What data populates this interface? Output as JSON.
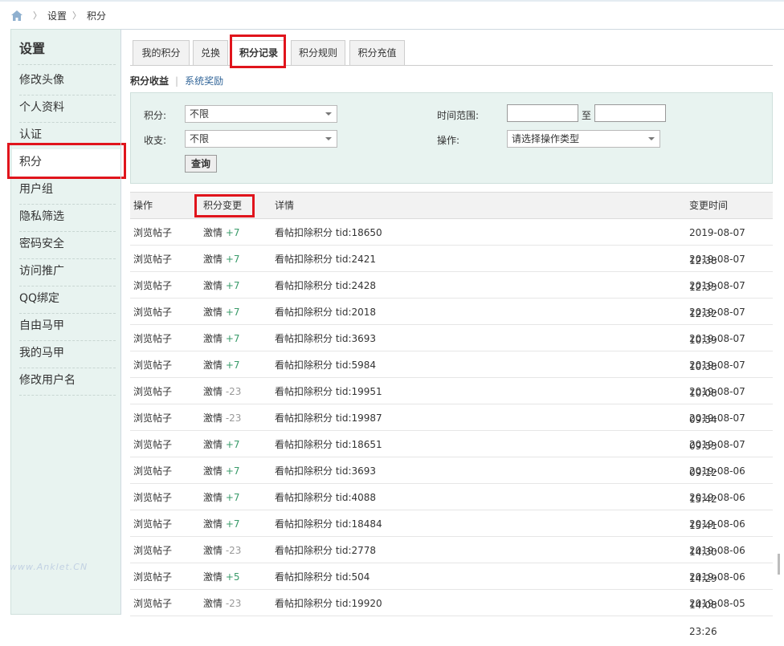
{
  "breadcrumb": {
    "home_icon": "home-icon",
    "items": [
      "设置",
      "积分"
    ]
  },
  "sidebar": {
    "title": "设置",
    "items": [
      "修改头像",
      "个人资料",
      "认证",
      "积分",
      "用户组",
      "隐私筛选",
      "密码安全",
      "访问推广",
      "QQ绑定",
      "自由马甲",
      "我的马甲",
      "修改用户名"
    ],
    "active_index": 3
  },
  "tabs": [
    "我的积分",
    "兑换",
    "积分记录",
    "积分规则",
    "积分充值"
  ],
  "active_tab": 2,
  "subnav": {
    "current": "积分收益",
    "link": "系统奖励"
  },
  "filter": {
    "credit_label": "积分:",
    "credit_value": "不限",
    "income_label": "收支:",
    "income_value": "不限",
    "time_label": "时间范围:",
    "time_sep": "至",
    "op_label": "操作:",
    "op_placeholder": "请选择操作类型",
    "query_button": "查询"
  },
  "table": {
    "headers": [
      "操作",
      "积分变更",
      "详情",
      "变更时间"
    ],
    "rows": [
      {
        "op": "浏览帖子",
        "credit": "激情",
        "delta": "+7",
        "detail": "看帖扣除积分 tid:18650",
        "time": "2019-08-07 12:38"
      },
      {
        "op": "浏览帖子",
        "credit": "激情",
        "delta": "+7",
        "detail": "看帖扣除积分 tid:2421",
        "time": "2019-08-07 12:33"
      },
      {
        "op": "浏览帖子",
        "credit": "激情",
        "delta": "+7",
        "detail": "看帖扣除积分 tid:2428",
        "time": "2019-08-07 12:32"
      },
      {
        "op": "浏览帖子",
        "credit": "激情",
        "delta": "+7",
        "detail": "看帖扣除积分 tid:2018",
        "time": "2019-08-07 10:39"
      },
      {
        "op": "浏览帖子",
        "credit": "激情",
        "delta": "+7",
        "detail": "看帖扣除积分 tid:3693",
        "time": "2019-08-07 10:38"
      },
      {
        "op": "浏览帖子",
        "credit": "激情",
        "delta": "+7",
        "detail": "看帖扣除积分 tid:5984",
        "time": "2019-08-07 10:08"
      },
      {
        "op": "浏览帖子",
        "credit": "激情",
        "delta": "-23",
        "detail": "看帖扣除积分 tid:19951",
        "time": "2019-08-07 09:54"
      },
      {
        "op": "浏览帖子",
        "credit": "激情",
        "delta": "-23",
        "detail": "看帖扣除积分 tid:19987",
        "time": "2019-08-07 09:53"
      },
      {
        "op": "浏览帖子",
        "credit": "激情",
        "delta": "+7",
        "detail": "看帖扣除积分 tid:18651",
        "time": "2019-08-07 09:12"
      },
      {
        "op": "浏览帖子",
        "credit": "激情",
        "delta": "+7",
        "detail": "看帖扣除积分 tid:3693",
        "time": "2019-08-06 15:42"
      },
      {
        "op": "浏览帖子",
        "credit": "激情",
        "delta": "+7",
        "detail": "看帖扣除积分 tid:4088",
        "time": "2019-08-06 15:41"
      },
      {
        "op": "浏览帖子",
        "credit": "激情",
        "delta": "+7",
        "detail": "看帖扣除积分 tid:18484",
        "time": "2019-08-06 14:30"
      },
      {
        "op": "浏览帖子",
        "credit": "激情",
        "delta": "-23",
        "detail": "看帖扣除积分 tid:2778",
        "time": "2019-08-06 14:29"
      },
      {
        "op": "浏览帖子",
        "credit": "激情",
        "delta": "+5",
        "detail": "看帖扣除积分 tid:504",
        "time": "2019-08-06 14:08"
      },
      {
        "op": "浏览帖子",
        "credit": "激情",
        "delta": "-23",
        "detail": "看帖扣除积分 tid:19920",
        "time": "2019-08-05 23:26"
      }
    ]
  },
  "watermark": "www.Anklet.CN",
  "colors": {
    "highlight": "#e0141c",
    "positive": "#3a9b6a",
    "negative": "#999999",
    "panel": "#e8f3f0",
    "link": "#336699"
  }
}
